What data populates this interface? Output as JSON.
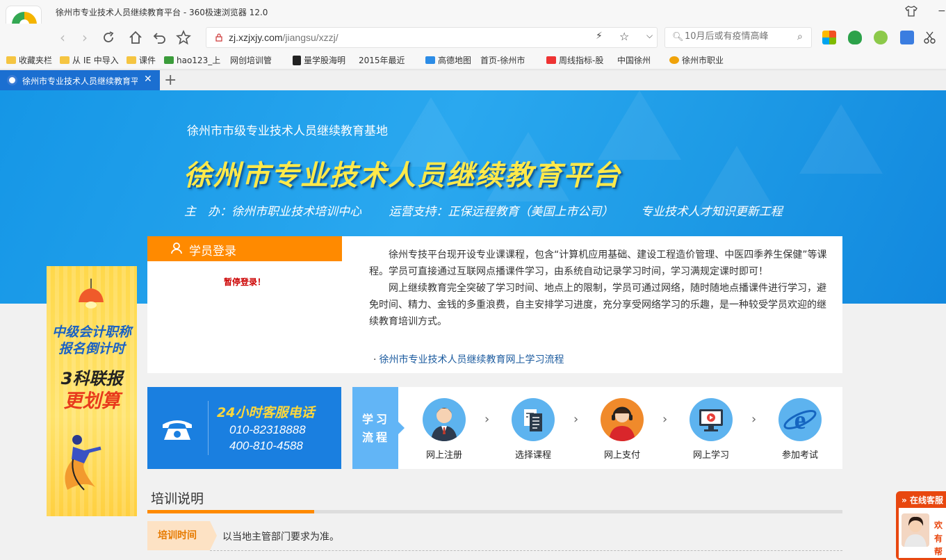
{
  "browser": {
    "window_title": "徐州市专业技术人员继续教育平台 - 360极速浏览器 12.0",
    "url_host": "zj.xzjxjy.com",
    "url_path": "/jiangsu/xzzj/",
    "search_placeholder": "10月后或有疫情高峰",
    "bookmarks": [
      "收藏夹栏",
      "从 IE 中导入",
      "课件",
      "hao123_上",
      "网创培训管",
      "量学股海明",
      "2015年最近",
      "高德地图",
      "首页-徐州市",
      "周线指标-股",
      "中国徐州",
      "徐州市职业"
    ],
    "tab_title": "徐州市专业技术人员继续教育平台"
  },
  "banner": {
    "subtitle": "徐州市市级专业技术人员继续教育基地",
    "title": "徐州市专业技术人员继续教育平台",
    "sponsors": [
      "主　办：徐州市职业技术培训中心",
      "运营支持：正保远程教育（美国上市公司）",
      "专业技术人才知识更新工程"
    ]
  },
  "login": {
    "title": "学员登录",
    "message": "暂停登录！"
  },
  "intro": {
    "paragraph1": "徐州专技平台现开设专业课课程，包含“计算机应用基础、建设工程造价管理、中医四季养生保健”等课程。学员可直接通过互联网点播课件学习，由系统自动记录学习时间，学习满规定课时即可！",
    "paragraph2": "网上继续教育完全突破了学习时间、地点上的限制，学员可通过网络，随时随地点播课件进行学习，避免时间、精力、金钱的多重浪费，自主安排学习进度，充分享受网络学习的乐趣，是一种较受学员欢迎的继续教育培训方式。",
    "link_bullet": "·",
    "link": "徐州市专业技术人员继续教育网上学习流程"
  },
  "hotline": {
    "title": "24小时客服电话",
    "numbers": [
      "010-82318888",
      "400-810-4588"
    ]
  },
  "flow": {
    "label_line1": "学习",
    "label_line2": "流程",
    "steps": [
      "网上注册",
      "选择课程",
      "网上支付",
      "网上学习",
      "参加考试"
    ]
  },
  "training": {
    "section_title": "培训说明",
    "row_label": "培训时间",
    "row_value": "以当地主管部门要求为准。"
  },
  "side_ad": {
    "line1": "中级会计职称",
    "line2": "报名倒计时",
    "line3": "3科联报",
    "line4": "更划算"
  },
  "customer_service": {
    "title": "在线客服",
    "line1": "欢",
    "line2": "有",
    "line3": "帮"
  },
  "colors": {
    "accent_orange": "#ff8a00",
    "banner_blue": "#1e9be6",
    "hotline_blue": "#1a7fe0",
    "title_yellow": "#ffe94a"
  }
}
